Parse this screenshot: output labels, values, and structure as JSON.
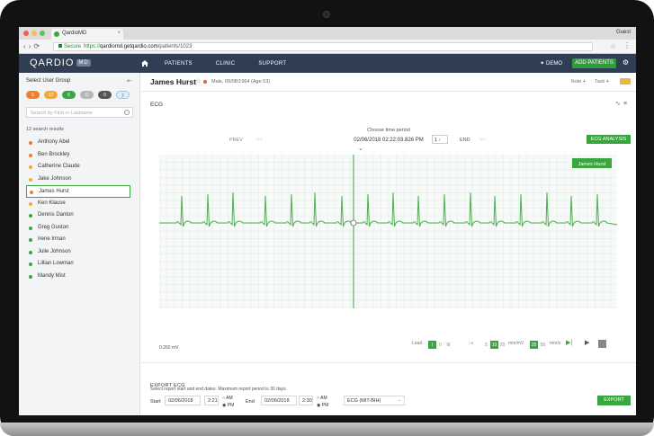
{
  "browser": {
    "tab_title": "QardioMD",
    "user": "Guest",
    "url_secure": "Secure",
    "url_prefix": "https://",
    "url_host": "qardiomd.getqardio.com",
    "url_path": "/patients/1023"
  },
  "app": {
    "logo": "QARDIO",
    "logo_badge": "MD",
    "nav": [
      "PATIENTS",
      "CLINIC",
      "SUPPORT"
    ],
    "demo": "DEMO",
    "add_patients": "ADD PATIENTS"
  },
  "sidebar": {
    "title": "Select User Group",
    "pills": [
      {
        "label": "5",
        "color": "#f07f2d"
      },
      {
        "label": "17",
        "color": "#f4a83a"
      },
      {
        "label": "6",
        "color": "#3aa640"
      },
      {
        "label": "0",
        "color": "#b8b8b8"
      },
      {
        "label": "0",
        "color": "#555555"
      },
      {
        "label": "2",
        "color": "#dff0fb"
      }
    ],
    "search_placeholder": "Search by First or Lastname",
    "results": "12 search results",
    "patients": [
      {
        "name": "Anthony Abel",
        "color": "#f07f2d"
      },
      {
        "name": "Ben Brockley",
        "color": "#f07f2d"
      },
      {
        "name": "Catherine Claude",
        "color": "#f4a83a"
      },
      {
        "name": "Jake Johnson",
        "color": "#f4a83a"
      },
      {
        "name": "James Hurst",
        "color": "#f07f2d"
      },
      {
        "name": "Ken Klause",
        "color": "#f4a83a"
      },
      {
        "name": "Dennis Danton",
        "color": "#3aa640"
      },
      {
        "name": "Greg Guston",
        "color": "#3aa640"
      },
      {
        "name": "Irene Irman",
        "color": "#3aa640"
      },
      {
        "name": "Julie Johnson",
        "color": "#3aa640"
      },
      {
        "name": "Lillian Lowman",
        "color": "#3aa640"
      },
      {
        "name": "Mandy Mist",
        "color": "#3aa640"
      }
    ],
    "selected_index": 4
  },
  "patient": {
    "name": "James Hurst",
    "info": "Male, 09/08/1964 (Age 53)",
    "note": "Note",
    "task": "Task"
  },
  "ecg": {
    "title": "ECG",
    "period_label": "Choose time period",
    "period": "02/06/2018 02:22:03.826 PM",
    "prev": "PREV",
    "page": "1",
    "end": "END",
    "analysis": "ECG ANALYSIS",
    "series_label": "James Hurst",
    "scale": "0.260 mV",
    "lead_label": "Lead",
    "lead_values": [
      "I",
      "II",
      "III"
    ],
    "gain_values": [
      "5",
      "10",
      "20"
    ],
    "gain_unit": "mm/mV",
    "speed_values": [
      "25",
      "50"
    ],
    "speed_unit": "mm/s"
  },
  "export": {
    "title": "EXPORT ECG",
    "start_label": "Start",
    "start_date": "02/06/2018",
    "start_time": "2:21",
    "am": "AM",
    "pm": "PM",
    "end_label": "End",
    "end_date": "02/06/2018",
    "end_time": "2:30",
    "format": "ECG (MIT-BIH)",
    "button": "EXPORT",
    "note": "Select report start and end dates. Maximum report period is 30 days."
  },
  "colors": {
    "nav_bg": "#2f3e52",
    "accent": "#3aa640",
    "ecg_line": "#4cae4f",
    "grid": "#dfe9e2"
  }
}
